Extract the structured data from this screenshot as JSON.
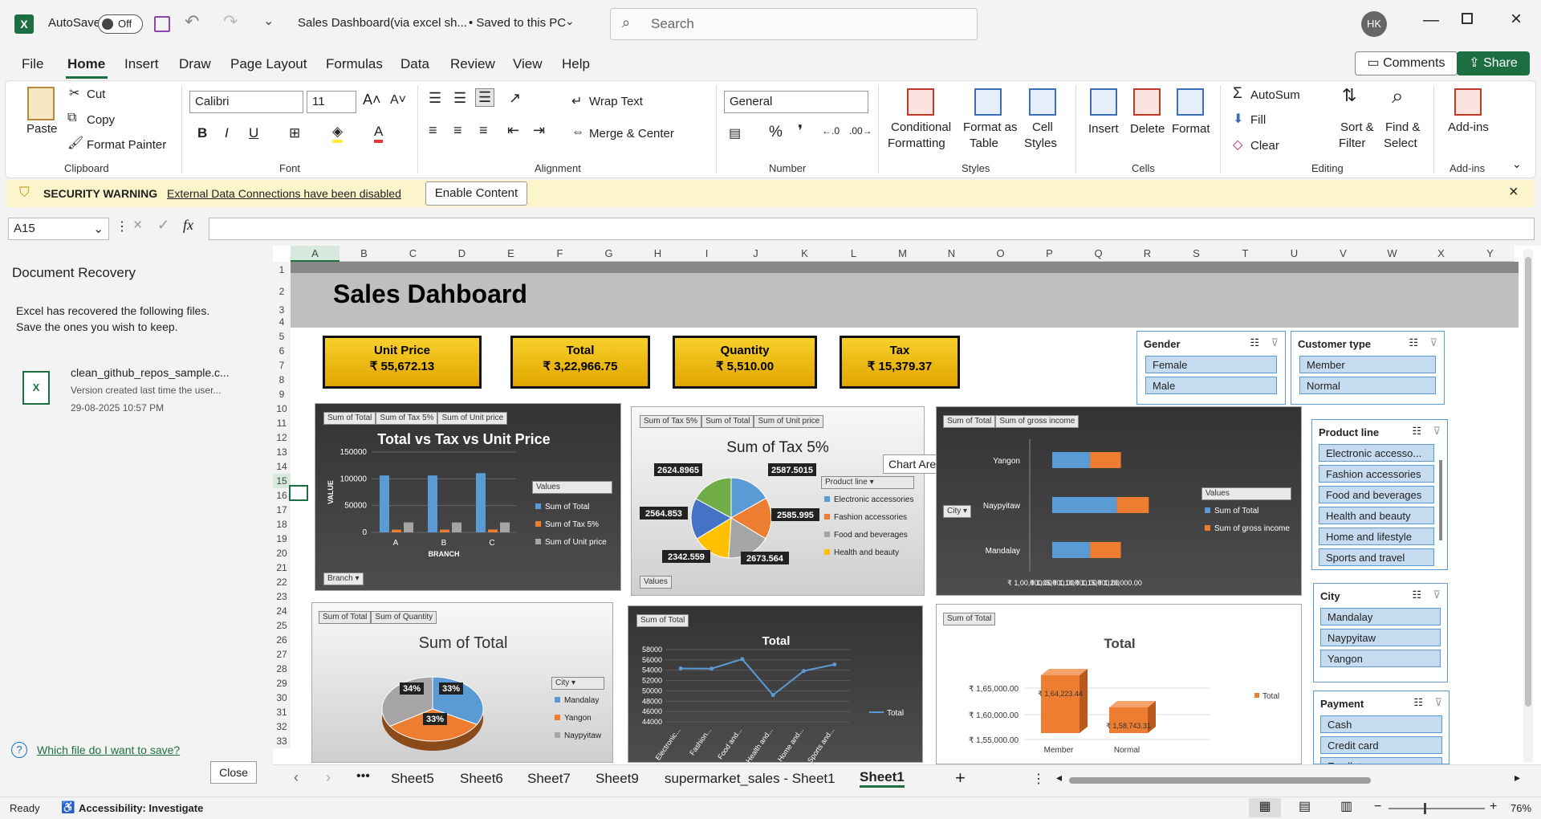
{
  "titlebar": {
    "autosave_label": "AutoSave",
    "autosave_state": "Off",
    "file_title": "Sales Dashboard(via excel sh...",
    "saved_status": "• Saved to this PC",
    "search_placeholder": "Search",
    "user_initials": "HK"
  },
  "menu": {
    "tabs": [
      "File",
      "Home",
      "Insert",
      "Draw",
      "Page Layout",
      "Formulas",
      "Data",
      "Review",
      "View",
      "Help"
    ],
    "comments_label": "Comments",
    "share_label": "Share"
  },
  "ribbon": {
    "clipboard": {
      "paste": "Paste",
      "cut": "Cut",
      "copy": "Copy",
      "format_painter": "Format Painter",
      "label": "Clipboard"
    },
    "font": {
      "name": "Calibri",
      "size": "11",
      "label": "Font"
    },
    "alignment": {
      "wrap_text": "Wrap Text",
      "merge_center": "Merge & Center",
      "label": "Alignment"
    },
    "number": {
      "format": "General",
      "label": "Number"
    },
    "styles": {
      "conditional": "Conditional",
      "formatting": "Formatting",
      "format_as": "Format as",
      "table": "Table",
      "cell": "Cell",
      "styles_word": "Styles",
      "label": "Styles"
    },
    "cells": {
      "insert": "Insert",
      "delete": "Delete",
      "format": "Format",
      "label": "Cells"
    },
    "editing": {
      "autosum": "AutoSum",
      "fill": "Fill",
      "clear": "Clear",
      "sort": "Sort &",
      "filter": "Filter",
      "find": "Find &",
      "select": "Select",
      "label": "Editing"
    },
    "addins": {
      "addins": "Add-ins",
      "label": "Add-ins"
    }
  },
  "warning": {
    "title": "SECURITY WARNING",
    "message": "External Data Connections have been disabled",
    "button": "Enable Content"
  },
  "formula_bar": {
    "name_box": "A15",
    "fx": "fx",
    "value": ""
  },
  "recovery": {
    "title": "Document Recovery",
    "desc1": "Excel has recovered the following files.",
    "desc2": "Save the ones you wish to keep.",
    "file_name": "clean_github_repos_sample.c...",
    "file_version": "Version created last time the user...",
    "file_date": "29-08-2025 10:57 PM",
    "help_link": "Which file do I want to save?",
    "close_button": "Close"
  },
  "columns": [
    "A",
    "B",
    "C",
    "D",
    "E",
    "F",
    "G",
    "H",
    "I",
    "J",
    "K",
    "L",
    "M",
    "N",
    "O",
    "P",
    "Q",
    "R",
    "S",
    "T",
    "U",
    "V",
    "W",
    "X",
    "Y"
  ],
  "rows": [
    "1",
    "2",
    "3",
    "4",
    "5",
    "6",
    "7",
    "8",
    "9",
    "10",
    "11",
    "12",
    "13",
    "14",
    "15",
    "16",
    "17",
    "18",
    "19",
    "20",
    "21",
    "22",
    "23",
    "24",
    "25",
    "26",
    "27",
    "28",
    "29",
    "30",
    "31",
    "32",
    "33"
  ],
  "dashboard": {
    "title": "Sales Dahboard",
    "kpis": [
      {
        "label": "Unit Price",
        "value": "₹ 55,672.13"
      },
      {
        "label": "Total",
        "value": "₹ 3,22,966.75"
      },
      {
        "label": "Quantity",
        "value": "₹ 5,510.00"
      },
      {
        "label": "Tax",
        "value": "₹ 15,379.37"
      }
    ],
    "tooltip": "Chart Area"
  },
  "chart1_ui": {
    "buttons": [
      "Sum of Total",
      "Sum of Tax 5%",
      "Sum of Unit price"
    ],
    "filter": "Branch",
    "legend_title": "Values"
  },
  "chart2_ui": {
    "buttons": [
      "Sum of Tax 5%",
      "Sum of Total",
      "Sum of Unit price"
    ],
    "legend_title": "Product line",
    "values_btn": "Values"
  },
  "chart3_ui": {
    "buttons": [
      "Sum of Total",
      "Sum of gross income"
    ],
    "filter": "City",
    "legend_title": "Values"
  },
  "chart4_ui": {
    "buttons": [
      "Sum of Total",
      "Sum of Quantity"
    ],
    "legend_title": "City"
  },
  "chart5_ui": {
    "buttons": [
      "Sum of Total"
    ]
  },
  "chart6_ui": {
    "buttons": [
      "Sum of Total"
    ]
  },
  "chart_data": [
    {
      "type": "bar",
      "title": "Total vs Tax vs Unit Price",
      "xlabel": "BRANCH",
      "ylabel": "VALUE",
      "categories": [
        "A",
        "B",
        "C"
      ],
      "yticks": [
        "150000",
        "100000",
        "50000",
        "0"
      ],
      "ylim": [
        0,
        150000
      ],
      "series": [
        {
          "name": "Sum of Total",
          "values": [
            106200,
            106197,
            110569
          ],
          "color": "#5b9bd5"
        },
        {
          "name": "Sum of Tax 5%",
          "values": [
            5057,
            5057,
            5265
          ],
          "color": "#ed7d31"
        },
        {
          "name": "Sum of Unit price",
          "values": [
            18625,
            18478,
            18568
          ],
          "color": "#a5a5a5"
        }
      ]
    },
    {
      "type": "pie",
      "title": "Sum of Tax 5%",
      "labels": [
        "Electronic accessories",
        "Fashion accessories",
        "Food and beverages",
        "Health and beauty",
        "Home and lifestyle",
        "Sports and travel"
      ],
      "values": [
        2587.5015,
        2585.995,
        2673.564,
        2342.559,
        2564.853,
        2624.8965
      ],
      "value_labels": [
        "2587.5015",
        "2585.995",
        "2673.564",
        "2342.559",
        "2564.853",
        "2624.8965"
      ],
      "legend_shown": [
        "Electronic accessories",
        "Fashion accessories",
        "Food and beverages",
        "Health and beauty"
      ],
      "colors": [
        "#5b9bd5",
        "#ed7d31",
        "#a5a5a5",
        "#ffc000",
        "#4472c4",
        "#70ad47"
      ]
    },
    {
      "type": "bar",
      "orientation": "horizontal",
      "stacked": true,
      "categories": [
        "Yangon",
        "Naypyitaw",
        "Mandalay"
      ],
      "xticks": [
        "₹ 1,00,000.00",
        "₹ 1,05,000.00",
        "₹ 1,10,000.00",
        "₹ 1,15,000.00",
        "₹ 1,20,000.00"
      ],
      "series": [
        {
          "name": "Sum of Total",
          "values": [
            106200,
            110568,
            106197
          ],
          "color": "#5b9bd5"
        },
        {
          "name": "Sum of gross income",
          "values": [
            5057,
            5265,
            5057
          ],
          "color": "#ed7d31"
        }
      ]
    },
    {
      "type": "pie",
      "title": "Sum of Total",
      "labels": [
        "Mandalay",
        "Yangon",
        "Naypyitaw"
      ],
      "values": [
        33,
        33,
        34
      ],
      "value_labels": [
        "33%",
        "33%",
        "34%"
      ],
      "colors": [
        "#5b9bd5",
        "#ed7d31",
        "#a5a5a5"
      ]
    },
    {
      "type": "line",
      "title": "Total",
      "categories": [
        "Electronic...",
        "Fashion...",
        "Food and...",
        "Health and...",
        "Home and...",
        "Sports and..."
      ],
      "yticks": [
        "58000",
        "56000",
        "54000",
        "52000",
        "50000",
        "48000",
        "46000",
        "44000"
      ],
      "ylim": [
        44000,
        58000
      ],
      "series": [
        {
          "name": "Total",
          "values": [
            54337,
            54306,
            56144,
            49193,
            53861,
            55123
          ],
          "color": "#5b9bd5"
        }
      ]
    },
    {
      "type": "bar",
      "title": "Total",
      "categories": [
        "Member",
        "Normal"
      ],
      "yticks": [
        "₹ 1,65,000.00",
        "₹ 1,60,000.00",
        "₹ 1,55,000.00"
      ],
      "value_labels": [
        "₹ 1,64,223.44",
        "₹ 1,58,743.31"
      ],
      "series": [
        {
          "name": "Total",
          "values": [
            164223.44,
            158743.31
          ],
          "color": "#ed7d31"
        }
      ]
    }
  ],
  "slicers": {
    "gender": {
      "title": "Gender",
      "items": [
        "Female",
        "Male"
      ]
    },
    "customer_type": {
      "title": "Customer type",
      "items": [
        "Member",
        "Normal"
      ]
    },
    "product_line": {
      "title": "Product line",
      "items": [
        "Electronic accesso...",
        "Fashion accessories",
        "Food and beverages",
        "Health and beauty",
        "Home and lifestyle",
        "Sports and travel"
      ]
    },
    "city": {
      "title": "City",
      "items": [
        "Mandalay",
        "Naypyitaw",
        "Yangon"
      ]
    },
    "payment": {
      "title": "Payment",
      "items": [
        "Cash",
        "Credit card",
        "Ewallet"
      ]
    }
  },
  "sheet_tabs": [
    "Sheet5",
    "Sheet6",
    "Sheet7",
    "Sheet9",
    "supermarket_sales - Sheet1",
    "Sheet1"
  ],
  "active_sheet": "Sheet1",
  "status": {
    "ready": "Ready",
    "accessibility": "Accessibility: Investigate",
    "zoom": "76%"
  }
}
